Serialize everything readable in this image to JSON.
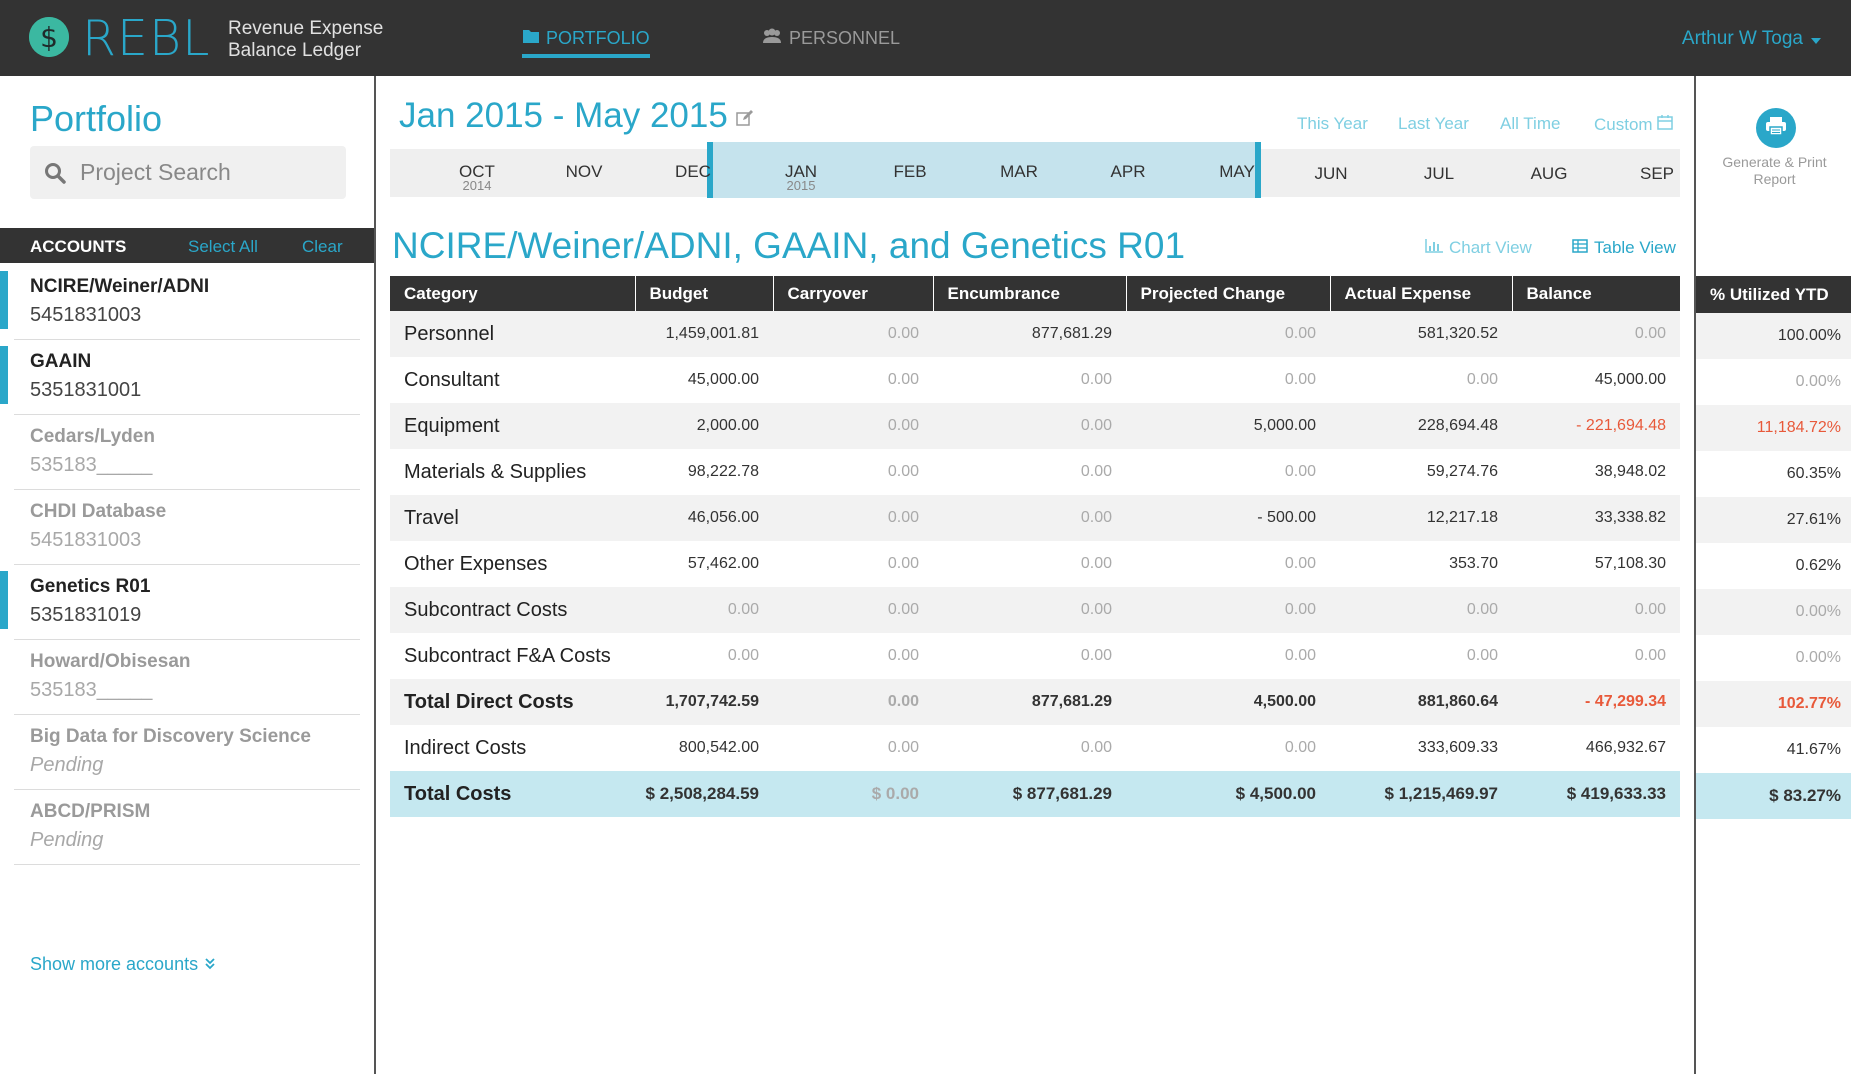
{
  "header": {
    "logo_text": "REBL",
    "logo_sub_line1": "Revenue Expense",
    "logo_sub_line2": "Balance Ledger",
    "nav": {
      "portfolio": "PORTFOLIO",
      "personnel": "PERSONNEL"
    },
    "user": "Arthur W Toga"
  },
  "sidebar": {
    "title": "Portfolio",
    "search_placeholder": "Project Search",
    "accounts_label": "ACCOUNTS",
    "select_all": "Select All",
    "clear": "Clear",
    "accounts": [
      {
        "name": "NCIRE/Weiner/ADNI",
        "number": "5451831003",
        "state": "active"
      },
      {
        "name": "GAAIN",
        "number": "5351831001",
        "state": "active"
      },
      {
        "name": "Cedars/Lyden",
        "number": "535183_____",
        "state": "inactive"
      },
      {
        "name": "CHDI Database",
        "number": "5451831003",
        "state": "inactive"
      },
      {
        "name": "Genetics R01",
        "number": "5351831019",
        "state": "active"
      },
      {
        "name": "Howard/Obisesan",
        "number": "535183_____",
        "state": "inactive"
      },
      {
        "name": "Big Data for Discovery Science",
        "number": "Pending",
        "state": "pending"
      },
      {
        "name": "ABCD/PRISM",
        "number": "Pending",
        "state": "pending"
      }
    ],
    "show_more": "Show more accounts"
  },
  "main": {
    "range_title": "Jan 2015 - May 2015",
    "quick_ranges": {
      "this_year": "This Year",
      "last_year": "Last Year",
      "all_time": "All Time",
      "custom": "Custom"
    },
    "timeline": [
      {
        "month": "OCT",
        "year": "2014"
      },
      {
        "month": "NOV",
        "year": ""
      },
      {
        "month": "DEC",
        "year": ""
      },
      {
        "month": "JAN",
        "year": "2015"
      },
      {
        "month": "FEB",
        "year": ""
      },
      {
        "month": "MAR",
        "year": ""
      },
      {
        "month": "APR",
        "year": ""
      },
      {
        "month": "MAY",
        "year": ""
      },
      {
        "month": "JUN",
        "year": ""
      },
      {
        "month": "JUL",
        "year": ""
      },
      {
        "month": "AUG",
        "year": ""
      },
      {
        "month": "SEP",
        "year": ""
      }
    ],
    "table_title": "NCIRE/Weiner/ADNI, GAAIN, and Genetics R01",
    "chart_view": "Chart View",
    "table_view": "Table View",
    "columns": [
      "Category",
      "Budget",
      "Carryover",
      "Encumbrance",
      "Projected Change",
      "Actual Expense",
      "Balance"
    ],
    "rows": [
      [
        "Personnel",
        "1,459,001.81",
        "0.00",
        "877,681.29",
        "0.00",
        "581,320.52",
        "0.00"
      ],
      [
        "Consultant",
        "45,000.00",
        "0.00",
        "0.00",
        "0.00",
        "0.00",
        "45,000.00"
      ],
      [
        "Equipment",
        "2,000.00",
        "0.00",
        "0.00",
        "5,000.00",
        "228,694.48",
        "- 221,694.48"
      ],
      [
        "Materials & Supplies",
        "98,222.78",
        "0.00",
        "0.00",
        "0.00",
        "59,274.76",
        "38,948.02"
      ],
      [
        "Travel",
        "46,056.00",
        "0.00",
        "0.00",
        "- 500.00",
        "12,217.18",
        "33,338.82"
      ],
      [
        "Other Expenses",
        "57,462.00",
        "0.00",
        "0.00",
        "0.00",
        "353.70",
        "57,108.30"
      ],
      [
        "Subcontract Costs",
        "0.00",
        "0.00",
        "0.00",
        "0.00",
        "0.00",
        "0.00"
      ],
      [
        "Subcontract F&A Costs",
        "0.00",
        "0.00",
        "0.00",
        "0.00",
        "0.00",
        "0.00"
      ],
      [
        "Total Direct Costs",
        "1,707,742.59",
        "0.00",
        "877,681.29",
        "4,500.00",
        "881,860.64",
        "- 47,299.34"
      ],
      [
        "Indirect Costs",
        "800,542.00",
        "0.00",
        "0.00",
        "0.00",
        "333,609.33",
        "466,932.67"
      ],
      [
        "Total Costs",
        "$ 2,508,284.59",
        "$ 0.00",
        "$ 877,681.29",
        "$ 4,500.00",
        "$ 1,215,469.97",
        "$ 419,633.33"
      ]
    ]
  },
  "utilization": {
    "print_label_line1": "Generate & Print",
    "print_label_line2": "Report",
    "header": "% Utilized YTD",
    "values": [
      "100.00%",
      "0.00%",
      "11,184.72%",
      "60.35%",
      "27.61%",
      "0.62%",
      "0.00%",
      "0.00%",
      "102.77%",
      "41.67%",
      "$ 83.27%"
    ]
  },
  "colors": {
    "accent": "#2aa7c9",
    "header_bg": "#333333",
    "negative": "#e8593a",
    "selected_range": "#c5e3ed",
    "total_row": "#c5e8f0"
  }
}
